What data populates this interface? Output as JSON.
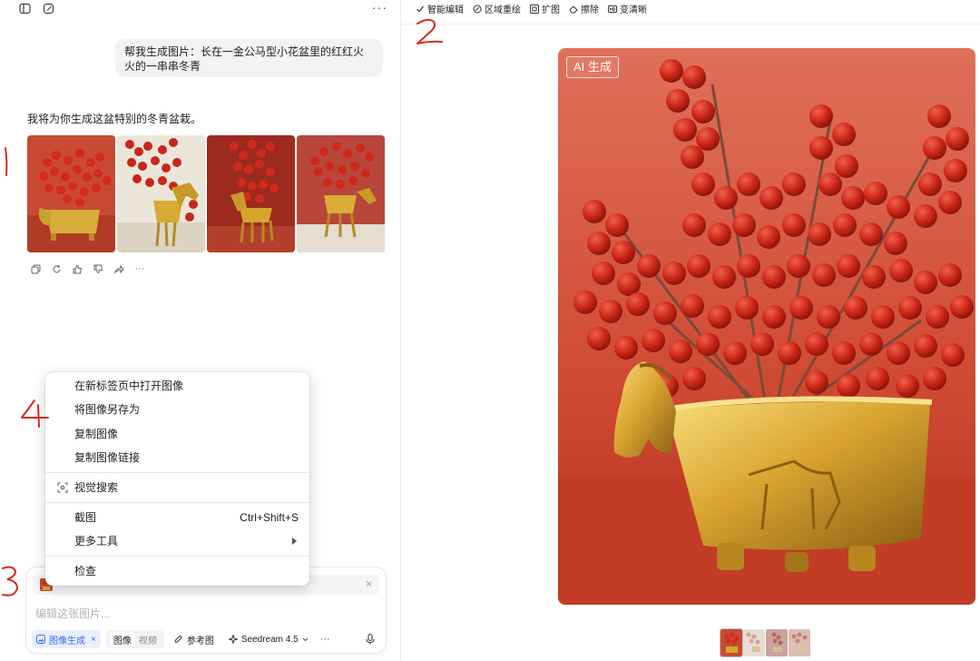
{
  "conversation": {
    "user_message": "帮我生成图片：长在一金公马型小花盆里的红红火火的一串串冬青",
    "assistant_message": "我将为你生成这盆特别的冬青盆栽。",
    "thumbnail_count": 4
  },
  "top_icons": [
    "sidebar-toggle-icon",
    "new-chat-icon"
  ],
  "more_label": "···",
  "message_actions": [
    "copy-icon",
    "regenerate-icon",
    "thumbs-up-icon",
    "thumbs-down-icon",
    "share-icon",
    "more-icon"
  ],
  "message_actions_more": "···",
  "context_menu": {
    "items": [
      {
        "label": "在新标签页中打开图像"
      },
      {
        "label": "将图像另存为"
      },
      {
        "label": "复制图像"
      },
      {
        "label": "复制图像链接"
      },
      {
        "label": "视觉搜索",
        "icon": "visual-search-icon"
      },
      {
        "label": "截图",
        "shortcut": "Ctrl+Shift+S"
      },
      {
        "label": "更多工具",
        "submenu": true
      },
      {
        "label": "检查"
      }
    ]
  },
  "composer": {
    "placeholder": "编辑这张图片...",
    "attachment_close": "×",
    "mode_label": "图像生成",
    "mode_close": "×",
    "seg_image": "图像",
    "seg_video": "视频",
    "reference_label": "参考图",
    "model_label": "Seedream 4.5",
    "more": "···"
  },
  "right_toolbar": {
    "items": [
      {
        "label": "智能编辑",
        "icon": "check-icon"
      },
      {
        "label": "区域重绘",
        "icon": "brush-icon"
      },
      {
        "label": "扩图",
        "icon": "expand-icon"
      },
      {
        "label": "擦除",
        "icon": "eraser-icon"
      },
      {
        "label": "变清晰",
        "icon": "hd-icon"
      }
    ]
  },
  "preview": {
    "badge": "AI 生成",
    "thumbnail_count": 4,
    "selected_index": 0
  },
  "annotations": [
    "1",
    "2",
    "3",
    "4"
  ],
  "colors": {
    "accent_blue": "#3a6cf0",
    "annotation_red": "#d8281f",
    "background_red": "#c9442c",
    "berry_red": "#c8261a",
    "gold": "#d4a72c"
  }
}
